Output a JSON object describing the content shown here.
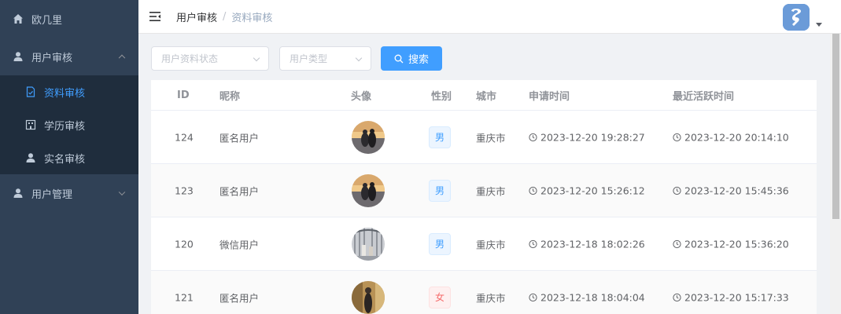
{
  "sidebar": {
    "items": [
      {
        "label": "欧几里",
        "icon": "home-icon"
      },
      {
        "label": "用户审核",
        "icon": "user-icon",
        "expanded": true,
        "children": [
          {
            "label": "资料审核",
            "icon": "document-check-icon",
            "active": true
          },
          {
            "label": "学历审核",
            "icon": "building-icon"
          },
          {
            "label": "实名审核",
            "icon": "user-icon"
          }
        ]
      },
      {
        "label": "用户管理",
        "icon": "user-icon",
        "expanded": false
      }
    ]
  },
  "header": {
    "breadcrumb": [
      "用户审核",
      "资料审核"
    ],
    "separator": "/"
  },
  "filters": {
    "status_placeholder": "用户资料状态",
    "type_placeholder": "用户类型",
    "search_label": "搜索"
  },
  "table": {
    "columns": [
      "ID",
      "昵称",
      "头像",
      "性别",
      "城市",
      "申请时间",
      "最近活跃时间"
    ],
    "rows": [
      {
        "id": "124",
        "nickname": "匿名用户",
        "gender": "男",
        "gender_type": "male",
        "city": "重庆市",
        "apply_time": "2023-12-20 19:28:27",
        "active_time": "2023-12-20 20:14:10",
        "photo": "sunset-couple"
      },
      {
        "id": "123",
        "nickname": "匿名用户",
        "gender": "男",
        "gender_type": "male",
        "city": "重庆市",
        "apply_time": "2023-12-20 15:26:12",
        "active_time": "2023-12-20 15:45:36",
        "photo": "sunset-couple"
      },
      {
        "id": "120",
        "nickname": "微信用户",
        "gender": "男",
        "gender_type": "male",
        "city": "重庆市",
        "apply_time": "2023-12-18 18:02:26",
        "active_time": "2023-12-20 15:36:20",
        "photo": "indoor-hall"
      },
      {
        "id": "121",
        "nickname": "匿名用户",
        "gender": "女",
        "gender_type": "female",
        "city": "重庆市",
        "apply_time": "2023-12-18 18:04:04",
        "active_time": "2023-12-20 15:17:33",
        "photo": "portrait-woman"
      }
    ]
  },
  "colors": {
    "sidebar_bg": "#304156",
    "submenu_bg": "#1f2d3d",
    "accent": "#409eff",
    "female": "#f56c6c"
  }
}
